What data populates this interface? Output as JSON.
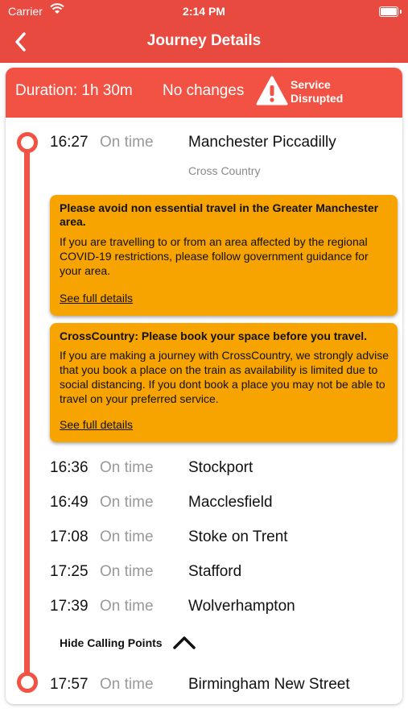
{
  "status_bar": {
    "carrier": "Carrier",
    "time": "2:14 PM"
  },
  "nav": {
    "title": "Journey Details"
  },
  "summary": {
    "duration": "Duration: 1h 30m",
    "changes": "No changes",
    "disruption_line1": "Service",
    "disruption_line2": "Disrupted"
  },
  "origin": {
    "time": "16:27",
    "status": "On time",
    "station": "Manchester Piccadilly",
    "operator": "Cross Country"
  },
  "alerts": [
    {
      "title": "Please avoid non essential travel in the Greater Manchester area.",
      "body": "If you are travelling to or from an area affected by the regional COVID-19 restrictions, please follow government guidance for your area.",
      "link": "See full details"
    },
    {
      "title": "CrossCountry: Please book your space before you travel.",
      "body": "If you are making a journey with CrossCountry, we strongly advise that you book a place on the train as availability is limited due to social distancing. If you dont book a place you may not be able to travel on your preferred service.",
      "link": "See full details"
    }
  ],
  "calling_points": [
    {
      "time": "16:36",
      "status": "On time",
      "station": "Stockport"
    },
    {
      "time": "16:49",
      "status": "On time",
      "station": "Macclesfield"
    },
    {
      "time": "17:08",
      "status": "On time",
      "station": "Stoke on Trent"
    },
    {
      "time": "17:25",
      "status": "On time",
      "station": "Stafford"
    },
    {
      "time": "17:39",
      "status": "On time",
      "station": "Wolverhampton"
    }
  ],
  "hide_calling_points": "Hide Calling Points",
  "destination": {
    "time": "17:57",
    "status": "On time",
    "station": "Birmingham New Street"
  },
  "colors": {
    "accent": "#e84a3f",
    "alert": "#f7a400",
    "muted": "#999999"
  }
}
